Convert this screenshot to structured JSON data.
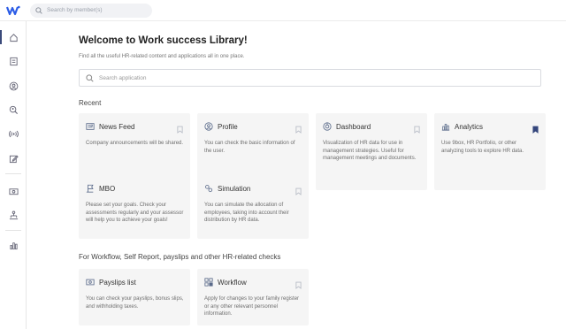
{
  "search_top": {
    "placeholder": "Search by member(s)"
  },
  "page": {
    "title": "Welcome to Work success Library!",
    "subtitle": "Find all the useful HR-related content and applications all in one place.",
    "search_placeholder": "Search application"
  },
  "recent": {
    "heading": "Recent",
    "cards": [
      {
        "title": "News Feed",
        "desc": "Company announcements will be shared.",
        "icon": "news-feed-icon",
        "bookmarked": false
      },
      {
        "title": "Profile",
        "desc": "You can check the basic information of the user.",
        "icon": "profile-icon",
        "bookmarked": false
      },
      {
        "title": "Dashboard",
        "desc": "Visualization of HR data for use in management strategies. Useful for management meetings and documents.",
        "icon": "dashboard-icon",
        "bookmarked": false
      },
      {
        "title": "Analytics",
        "desc": "Use 9box, HR Portfolio, or other analyzing tools to explore HR data.",
        "icon": "analytics-icon",
        "bookmarked": true
      },
      {
        "title": "MBO",
        "desc": "Please set your goals. Check your assessments regularly and your assessor will help you to achieve your goals!",
        "icon": "mbo-icon",
        "bookmarked": false
      },
      {
        "title": "Simulation",
        "desc": "You can simulate the allocation of employees, taking into account their distribution by HR data.",
        "icon": "simulation-icon",
        "bookmarked": false
      }
    ]
  },
  "workflow": {
    "heading": "For Workflow, Self Report, payslips and other HR-related checks",
    "cards": [
      {
        "title": "Payslips list",
        "desc": "You can check your payslips, bonus slips, and withholding taxes.",
        "icon": "payslip-icon",
        "bookmarked": false
      },
      {
        "title": "Workflow",
        "desc": "Apply for changes to your family register or any other relevant personnel information.",
        "icon": "workflow-icon",
        "bookmarked": false
      }
    ]
  },
  "sidebar_icons": [
    "home-icon",
    "document-icon",
    "person-icon",
    "people-search-icon",
    "broadcast-icon",
    "edit-icon",
    "money-icon",
    "org-chart-icon",
    "bar-chart-icon"
  ],
  "colors": {
    "accent": "#3a4a7a",
    "bookmark_active": "#34467c",
    "card_bg": "#f5f5f5",
    "logo_blue": "#2b5ce6"
  }
}
